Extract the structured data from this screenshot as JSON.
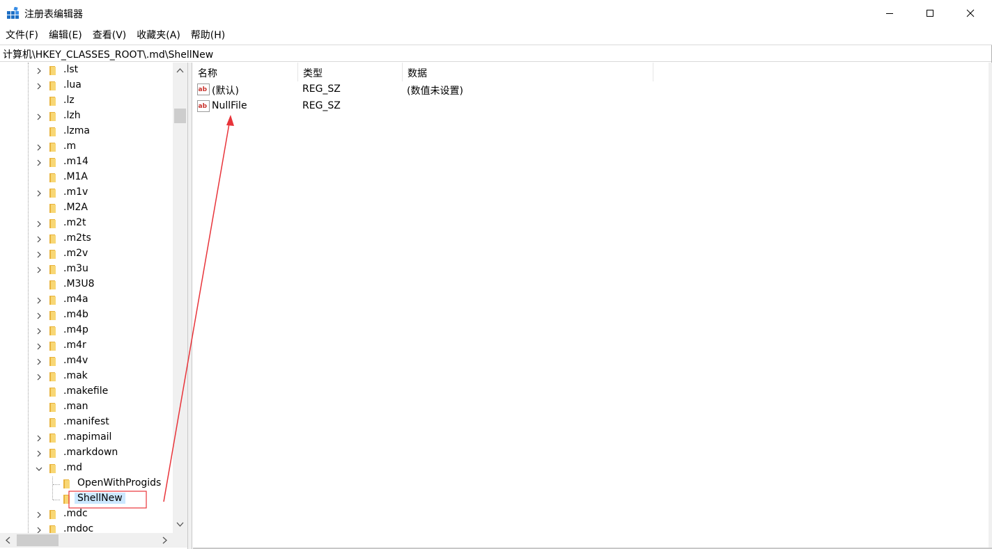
{
  "window": {
    "title": "注册表编辑器",
    "icon": "registry-editor-icon"
  },
  "menu": [
    {
      "label": "文件(F)"
    },
    {
      "label": "编辑(E)"
    },
    {
      "label": "查看(V)"
    },
    {
      "label": "收藏夹(A)"
    },
    {
      "label": "帮助(H)"
    }
  ],
  "address": {
    "path": "计算机\\HKEY_CLASSES_ROOT\\.md\\ShellNew"
  },
  "tree": {
    "items": [
      {
        "label": ".lst",
        "expander": "collapsed"
      },
      {
        "label": ".lua",
        "expander": "collapsed"
      },
      {
        "label": ".lz",
        "expander": "none"
      },
      {
        "label": ".lzh",
        "expander": "collapsed"
      },
      {
        "label": ".lzma",
        "expander": "none"
      },
      {
        "label": ".m",
        "expander": "collapsed"
      },
      {
        "label": ".m14",
        "expander": "collapsed"
      },
      {
        "label": ".M1A",
        "expander": "none"
      },
      {
        "label": ".m1v",
        "expander": "collapsed"
      },
      {
        "label": ".M2A",
        "expander": "none"
      },
      {
        "label": ".m2t",
        "expander": "collapsed"
      },
      {
        "label": ".m2ts",
        "expander": "collapsed"
      },
      {
        "label": ".m2v",
        "expander": "collapsed"
      },
      {
        "label": ".m3u",
        "expander": "collapsed"
      },
      {
        "label": ".M3U8",
        "expander": "none"
      },
      {
        "label": ".m4a",
        "expander": "collapsed"
      },
      {
        "label": ".m4b",
        "expander": "collapsed"
      },
      {
        "label": ".m4p",
        "expander": "collapsed"
      },
      {
        "label": ".m4r",
        "expander": "collapsed"
      },
      {
        "label": ".m4v",
        "expander": "collapsed"
      },
      {
        "label": ".mak",
        "expander": "collapsed"
      },
      {
        "label": ".makefile",
        "expander": "none"
      },
      {
        "label": ".man",
        "expander": "none"
      },
      {
        "label": ".manifest",
        "expander": "none"
      },
      {
        "label": ".mapimail",
        "expander": "collapsed"
      },
      {
        "label": ".markdown",
        "expander": "collapsed"
      },
      {
        "label": ".md",
        "expander": "expanded"
      },
      {
        "label": "OpenWithProgids",
        "expander": "none",
        "child": true
      },
      {
        "label": "ShellNew",
        "expander": "none",
        "child": true,
        "selected": true
      },
      {
        "label": ".mdc",
        "expander": "collapsed"
      },
      {
        "label": ".mdoc",
        "expander": "collapsed"
      }
    ]
  },
  "list": {
    "columns": [
      {
        "label": "名称"
      },
      {
        "label": "类型"
      },
      {
        "label": "数据"
      }
    ],
    "rows": [
      {
        "name": "(默认)",
        "type": "REG_SZ",
        "data": "(数值未设置)"
      },
      {
        "name": "NullFile",
        "type": "REG_SZ",
        "data": ""
      }
    ]
  },
  "colors": {
    "selection": "#cce8ff",
    "annotation": "#e8343a",
    "folder": "#f8d775"
  }
}
